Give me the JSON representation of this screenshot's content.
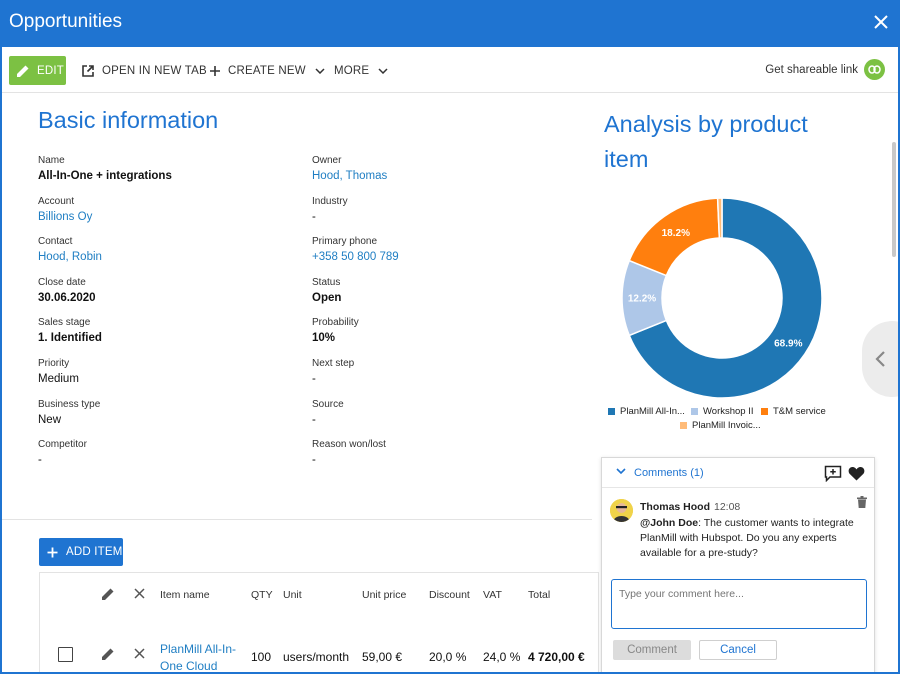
{
  "window": {
    "title": "Opportunities"
  },
  "toolbar": {
    "edit": "EDIT",
    "open_new_tab": "OPEN IN NEW TAB",
    "create_new": "CREATE NEW",
    "more": "MORE",
    "share": "Get shareable link"
  },
  "basic": {
    "heading": "Basic information",
    "fields": [
      {
        "label": "Name",
        "value": "All-In-One + integrations"
      },
      {
        "label": "Owner",
        "value": "Hood, Thomas"
      },
      {
        "label": "Account",
        "value": "Billions Oy"
      },
      {
        "label": "Industry",
        "value": "-"
      },
      {
        "label": "Contact",
        "value": "Hood, Robin"
      },
      {
        "label": "Primary phone",
        "value": "+358 50 800 789"
      },
      {
        "label": "Close date",
        "value": "30.06.2020"
      },
      {
        "label": "Status",
        "value": "Open"
      },
      {
        "label": "Sales stage",
        "value": "1. Identified"
      },
      {
        "label": "Probability",
        "value": "10%"
      },
      {
        "label": "Priority",
        "value": "Medium"
      },
      {
        "label": "Next step",
        "value": "-"
      },
      {
        "label": "Business type",
        "value": "New"
      },
      {
        "label": "Source",
        "value": "-"
      },
      {
        "label": "Competitor",
        "value": "-"
      },
      {
        "label": "Reason won/lost",
        "value": "-"
      }
    ]
  },
  "analysis": {
    "heading_line1": "Analysis by product",
    "heading_line2": "item"
  },
  "chart_data": {
    "type": "pie",
    "donut": true,
    "categories": [
      "PlanMill All-In...",
      "Workshop II",
      "T&M service",
      "PlanMill Invoic..."
    ],
    "values": [
      68.9,
      12.2,
      18.2,
      0.7
    ],
    "data_labels": [
      "68.9%",
      "12.2%",
      "18.2%",
      ""
    ],
    "colors": [
      "#1f77b4",
      "#aec7e8",
      "#ff7f0e",
      "#ffbb78"
    ],
    "legend_position": "bottom"
  },
  "items": {
    "add_button": "ADD ITEM",
    "headers": [
      "Item name",
      "QTY",
      "Unit",
      "Unit price",
      "Discount",
      "VAT",
      "Total"
    ],
    "rows": [
      {
        "name_line1": "PlanMill All-In-",
        "name_line2": "One Cloud",
        "qty": "100",
        "unit": "users/month",
        "unit_price": "59,00 €",
        "discount": "20,0 %",
        "vat": "24,0 %",
        "total": "4 720,00 €"
      }
    ]
  },
  "comments": {
    "title": "Comments (1)",
    "author": "Thomas Hood",
    "time": "12:08",
    "mention": "@John Doe",
    "text": ": The customer wants to integrate PlanMill with Hubspot. Do you any experts available for a pre-study?",
    "placeholder": "Type your comment here...",
    "comment_button": "Comment",
    "cancel_button": "Cancel"
  }
}
